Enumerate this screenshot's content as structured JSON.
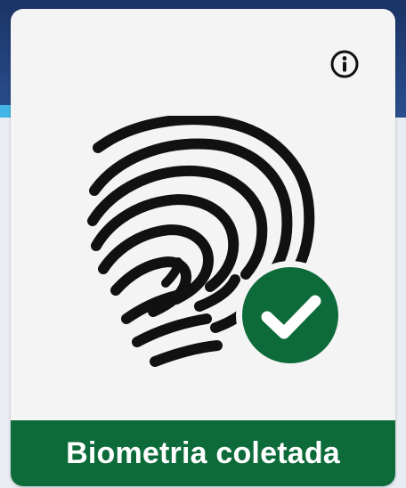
{
  "card": {
    "status_label": "Biometria coletada",
    "status_color": "#0d6b3a",
    "background_color": "#f4f4f4"
  },
  "icons": {
    "info": "info-icon",
    "fingerprint": "fingerprint-icon",
    "check": "check-circle-icon"
  },
  "colors": {
    "header_blue": "#1f3f78",
    "accent_cyan": "#43b6e6",
    "check_green": "#0d6b3a",
    "fingerprint_black": "#111111"
  }
}
